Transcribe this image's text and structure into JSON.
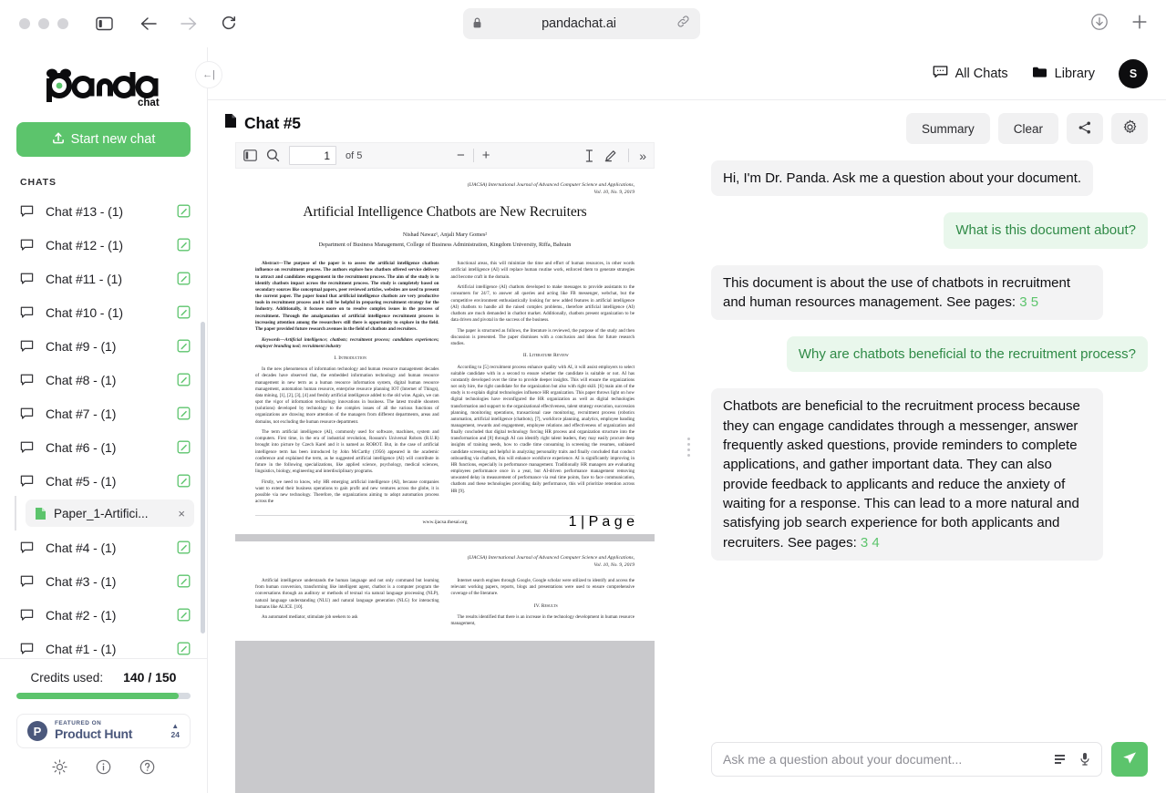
{
  "browser": {
    "url": "pandachat.ai",
    "lock_icon": "lock-icon",
    "link_icon": "link-icon",
    "back_icon": "back-arrow-icon",
    "forward_icon": "forward-arrow-icon",
    "reload_icon": "reload-icon",
    "sidebar_icon": "sidebar-toggle-icon",
    "download_icon": "download-icon",
    "newtab_icon": "plus-icon"
  },
  "sidebar": {
    "logo_text": "panda",
    "logo_sub": "chat",
    "new_chat_label": "Start new chat",
    "chats_heading": "CHATS",
    "chats": [
      {
        "label": "Chat #13 - (1)"
      },
      {
        "label": "Chat #12 - (1)"
      },
      {
        "label": "Chat #11 - (1)"
      },
      {
        "label": "Chat #10 - (1)"
      },
      {
        "label": "Chat #9 - (1)"
      },
      {
        "label": "Chat #8 - (1)"
      },
      {
        "label": "Chat #7 - (1)"
      },
      {
        "label": "Chat #6 - (1)"
      },
      {
        "label": "Chat #5 - (1)"
      },
      {
        "label": "Chat #4 - (1)"
      },
      {
        "label": "Chat #3 - (1)"
      },
      {
        "label": "Chat #2 - (1)"
      },
      {
        "label": "Chat #1 - (1)"
      }
    ],
    "attached_document": {
      "name": "Paper_1-Artifici...",
      "close": "×"
    },
    "credits": {
      "label": "Credits used:",
      "value": "140 / 150",
      "used": 140,
      "total": 150,
      "percent": 93
    },
    "product_hunt": {
      "featured": "FEATURED ON",
      "name": "Product Hunt",
      "votes": "24",
      "arrow": "▲"
    },
    "tools": [
      {
        "name": "theme-toggle-icon"
      },
      {
        "name": "info-icon"
      },
      {
        "name": "help-icon"
      }
    ],
    "collapse_label": "←|"
  },
  "topbar": {
    "all_chats": "All Chats",
    "library": "Library",
    "avatar_initial": "S"
  },
  "document_pane": {
    "title": "Chat #5",
    "toolbar": {
      "page_value": "1",
      "of_pages": "of 5",
      "zoom_out": "−",
      "zoom_in": "+",
      "sidebar_icon": "pdf-sidebar-icon",
      "search_icon": "search-icon",
      "text_select_icon": "text-cursor-icon",
      "draw_icon": "pencil-icon",
      "more_icon": "»"
    }
  },
  "pdf": {
    "page1": {
      "journal_line1": "(IJACSA) International Journal of Advanced Computer Science and Applications,",
      "journal_line2": "Vol. 10, No. 9, 2019",
      "title": "Artificial Intelligence Chatbots are New Recruiters",
      "authors": "Nishad Nawaz¹, Anjali Mary Gomes²",
      "affiliation": "Department of Business Management, College of Business Administration, Kingdom University, Riffa, Bahrain",
      "abstract": "Abstract—The purpose of the paper is to assess the artificial intelligence chatbots influence on recruitment process. The authors explore how chatbots offered service delivery to attract and candidates engagement in the recruitment process. The aim of the study is to identify chatbots impact across the recruitment process. The study is completely based on secondary sources like conceptual papers, peer reviewed articles, websites are used to present the current paper. The paper found that artificial intelligence chatbots are very productive tools in recruitment process and it will be helpful in preparing recruitment strategy for the Industry. Additionally, it focuses more on to resolve complex issues in the process of recruitment. Through the amalgamation of artificial intelligence recruitment process is increasing attention among the researchers still there is opportunity to explore in the field. The paper provided future research avenues in the field of chatbots and recruiters.",
      "keywords": "Keywords—Artificial intelligence; chatbots; recruitment process; candidates experiences; employer branding tool; recruitment industry",
      "section1": "I.   Introduction",
      "intro_p1": "In the new phenomenon of information technology and human resource management decades of decades have observed that, the embedded information technology and human resource management in new term as a human resource information system, digital human resource management, automation human resource, enterprise resource planning IOT (Internet of Things), data mining, [1], [2], [3], [4] and freshly artificial intelligence added to the old wine. Again, we can spot the vigor of information technology innovations in business. The latest trouble shooters (solutions) developed by technology to the complex issues of all the various functions of organizations are drawing more attention of the managers from different departments, areas and domains, not excluding the human resource department.",
      "intro_p2": "The term artificial intelligence (AI), commonly used for software, machines, system and computers. First time, in the era of industrial revolution, Rossum's Universal Robots (R.U.R) brought into picture by Czech Karel and it is named as ROBOT. But, in the case of artificial intelligence term has been introduced by John McCarthy (1956) appeared in the academic conference and explained the term, as he suggested artificial intelligence (AI) will contribute in future in the following specializations, like applied science, psychology, medical sciences, linguistics, biology, engineering and interdisciplinary programs.",
      "intro_p3": "Firstly, we need to know, why HR emerging artificial intelligence (AI), because companies want to extend their business operations to gain profit and new ventures across the globe, it is possible via new technology. Therefore, the organizations aiming to adopt automation process across the",
      "right_p1": "functional areas, this will minimize the time and effort of human resources, in other words artificial intelligence (AI) will replace human routine work, enforced them to generate strategies and become craft in the domain.",
      "right_p2": "Artificial intelligence (AI) chatbots developed to make messages to provide assistants to the consumers for 24/7, to answer all queries and acting like FB messenger, webchat, but the competitive environment enthusiastically looking for new added features in artificial intelligence (AI) chatbots to handle all the raised complex problems., therefore artificial intelligence (AI) chatbots are much demanded in chatbot market. Additionally, chatbots present organization to be data driven and pivotal in the success of the business.",
      "right_p3": "The paper is structured as follows, the literature is reviewed, the purpose of the study and then discussion is presented. The paper dismisses with a conclusion and ideas for future research studies.",
      "section2": "II.   Literature Review",
      "lit_p1": "According to [5] recruitment process enhance quality with AI, it will assist employers to select suitable candidate with in a second to ensure whether the candidate is suitable or not. AI has constantly developed over the time to provide deeper insights. This will ensure the organizations not only hire, the right candidate for the organization but also with right skill. [6] main aim of the study is to explain digital technologies influence HR organization. This paper throws light on how digital technologies have reconfigured the HR organization as well as digital technologies transformation and support to the organizational effectiveness, talent strategy execution, succession planning, monitoring operations, transactional case monitoring, recruitment process (robotics automation, artificial intelligence (chatbots), [7], workforce planning, analytics, employee banding  management, rewards and engagement, employee relations and effectiveness of organization and finally concluded that digital technology forcing HR process and organization structure into the transformation and [8] through AI can identify right talent leaders, they may easily procure deep insights of training needs, how to cradle time consuming in screening the resumes, unbiased candidate screening and helpful in analyzing personality traits and finally concluded that conduct onboarding via chatbots, this will enhance workforce experience. AI is significantly improving in HR functions, especially in performance management. Traditionally HR managers are evaluating employees performance once in a year, but AI-driven performance management removing unwanted delay in measurement of performance via real time points, face to face communication, chatbots and these technologies providing daily performance, this will prioritize retention across HR [9].",
      "website": "www.ijacsa.thesai.org",
      "page_number": "1 | P a g e"
    },
    "page2": {
      "journal_line1": "(IJACSA) International Journal of Advanced Computer Science and Applications,",
      "journal_line2": "Vol. 10, No. 9, 2019",
      "left_p1": "Artificial intelligence understands the human language and not only command but learning from human conversion, transforming like intelligent agent, chatbot is a computer program the conversations through an auditory or methods of textual via natural language processing (NLP), natural language understanding (NLU) and natural language generation (NLG) for interacting humans like ALICE. [10].",
      "left_p2": "An automated mediator, stimulate job seekers to ask",
      "right_p1": "Internet search engines through Google, Google scholar were utilized to identify and access the relevant working papers, reports, blogs and presentations were used to ensure comprehensive coverage of the literature.",
      "section4": "IV.   Results",
      "right_p2": "The results identified that there is an increase in the technology development in human resource management,"
    }
  },
  "chat": {
    "actions": {
      "summary": "Summary",
      "clear": "Clear",
      "share_icon": "share-icon",
      "settings_icon": "gear-icon"
    },
    "messages": [
      {
        "role": "bot",
        "text": "Hi, I'm Dr. Panda. Ask me a question about your document."
      },
      {
        "role": "user",
        "text": "What is this document about?"
      },
      {
        "role": "bot",
        "text": "This document is about the use of chatbots in recruitment and human resources management. See pages: ",
        "pages": "3 5"
      },
      {
        "role": "user",
        "text": "Why are chatbots beneficial to the recruitment process?"
      },
      {
        "role": "bot",
        "text": "Chatbots are beneficial to the recruitment process because they can engage candidates through a messenger, answer frequently asked questions, provide reminders to complete applications, and gather important data. They can also provide feedback to applicants and reduce the anxiety of waiting for a response. This can lead to a more natural and satisfying job search experience for both applicants and recruiters. See pages: ",
        "pages": "3 4"
      }
    ],
    "composer": {
      "placeholder": "Ask me a question about your document...",
      "value": "",
      "list_icon": "list-format-icon",
      "mic_icon": "microphone-icon",
      "send_icon": "send-icon"
    }
  },
  "colors": {
    "accent": "#5cc46c",
    "user_bubble": "#e9f7ec",
    "bot_bubble": "#f3f3f4",
    "avatar_bg": "#0d0d0f"
  }
}
